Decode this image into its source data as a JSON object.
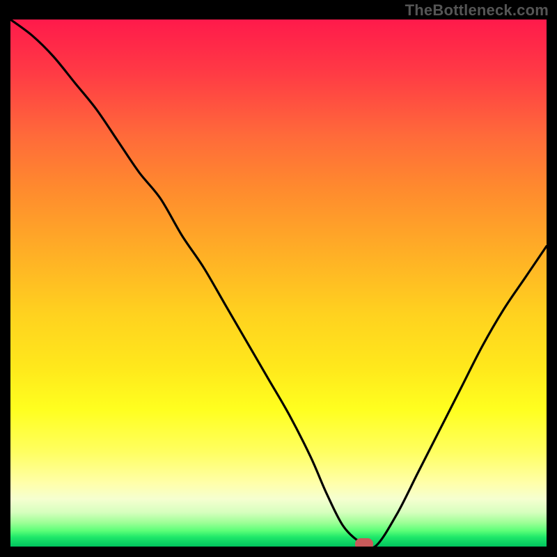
{
  "watermark": "TheBottleneck.com",
  "chart_data": {
    "type": "line",
    "title": "",
    "xlabel": "",
    "ylabel": "",
    "x_range": [
      0,
      100
    ],
    "y_range": [
      0,
      100
    ],
    "series": [
      {
        "name": "bottleneck-curve",
        "x": [
          0,
          4,
          8,
          12,
          16,
          20,
          24,
          28,
          32,
          36,
          40,
          44,
          48,
          52,
          56,
          59,
          62,
          65,
          68,
          72,
          76,
          80,
          84,
          88,
          92,
          96,
          100
        ],
        "values": [
          100,
          97,
          93,
          88,
          83,
          77,
          71,
          66,
          59,
          53,
          46,
          39,
          32,
          25,
          17,
          10,
          4,
          1,
          0,
          6,
          14,
          22,
          30,
          38,
          45,
          51,
          57
        ]
      }
    ],
    "marker": {
      "x": 66,
      "y": 0,
      "label": "optimal-point"
    },
    "background_gradient": {
      "top": "#ff1a4b",
      "middle": "#ffff1f",
      "bottom": "#00c45e"
    }
  }
}
